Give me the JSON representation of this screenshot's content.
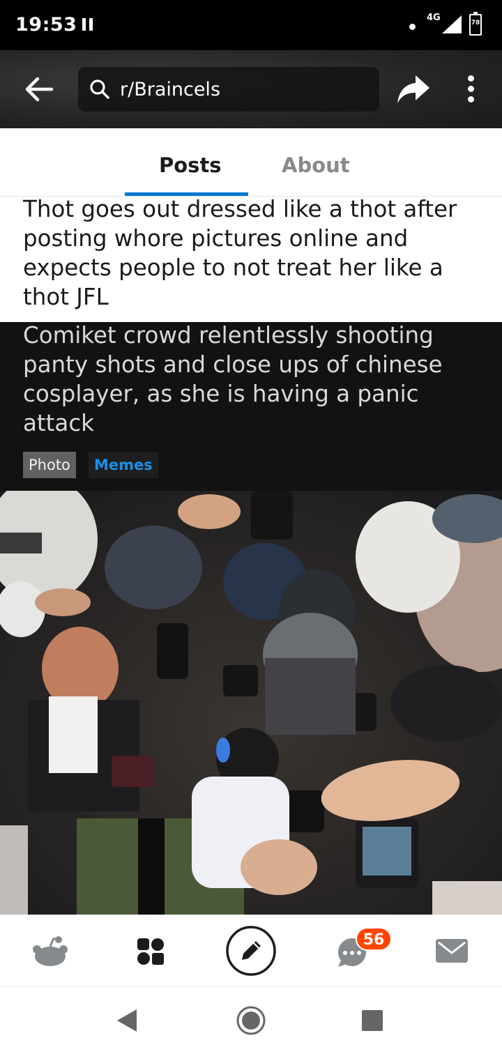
{
  "status_bar": {
    "time": "19:53",
    "network": "4G",
    "battery": "78"
  },
  "header": {
    "search_text": "r/Braincels",
    "icons": [
      "back-arrow-icon",
      "search-icon",
      "share-icon",
      "more-vertical-icon"
    ]
  },
  "tabs": [
    {
      "label": "Posts",
      "active": true
    },
    {
      "label": "About",
      "active": false
    }
  ],
  "posts": [
    {
      "title": "Thot goes out dressed like a thot after posting whore pictures online and expects people to not treat her like a thot JFL"
    },
    {
      "title": "Comiket crowd relentlessly shooting panty shots and close ups of chinese cosplayer, as she is having a panic attack",
      "flairs": [
        "Photo",
        "Memes"
      ]
    }
  ],
  "bottom_nav": {
    "items": [
      "home-icon",
      "communities-icon",
      "create-post-icon",
      "chat-icon",
      "inbox-icon"
    ],
    "chat_badge": "56"
  },
  "system_nav": [
    "back-triangle-icon",
    "home-circle-icon",
    "recents-square-icon"
  ],
  "colors": {
    "accent": "#0079d3",
    "badge": "#ff4500",
    "dark_card": "#121212",
    "flair_link": "#1a8fe6"
  }
}
